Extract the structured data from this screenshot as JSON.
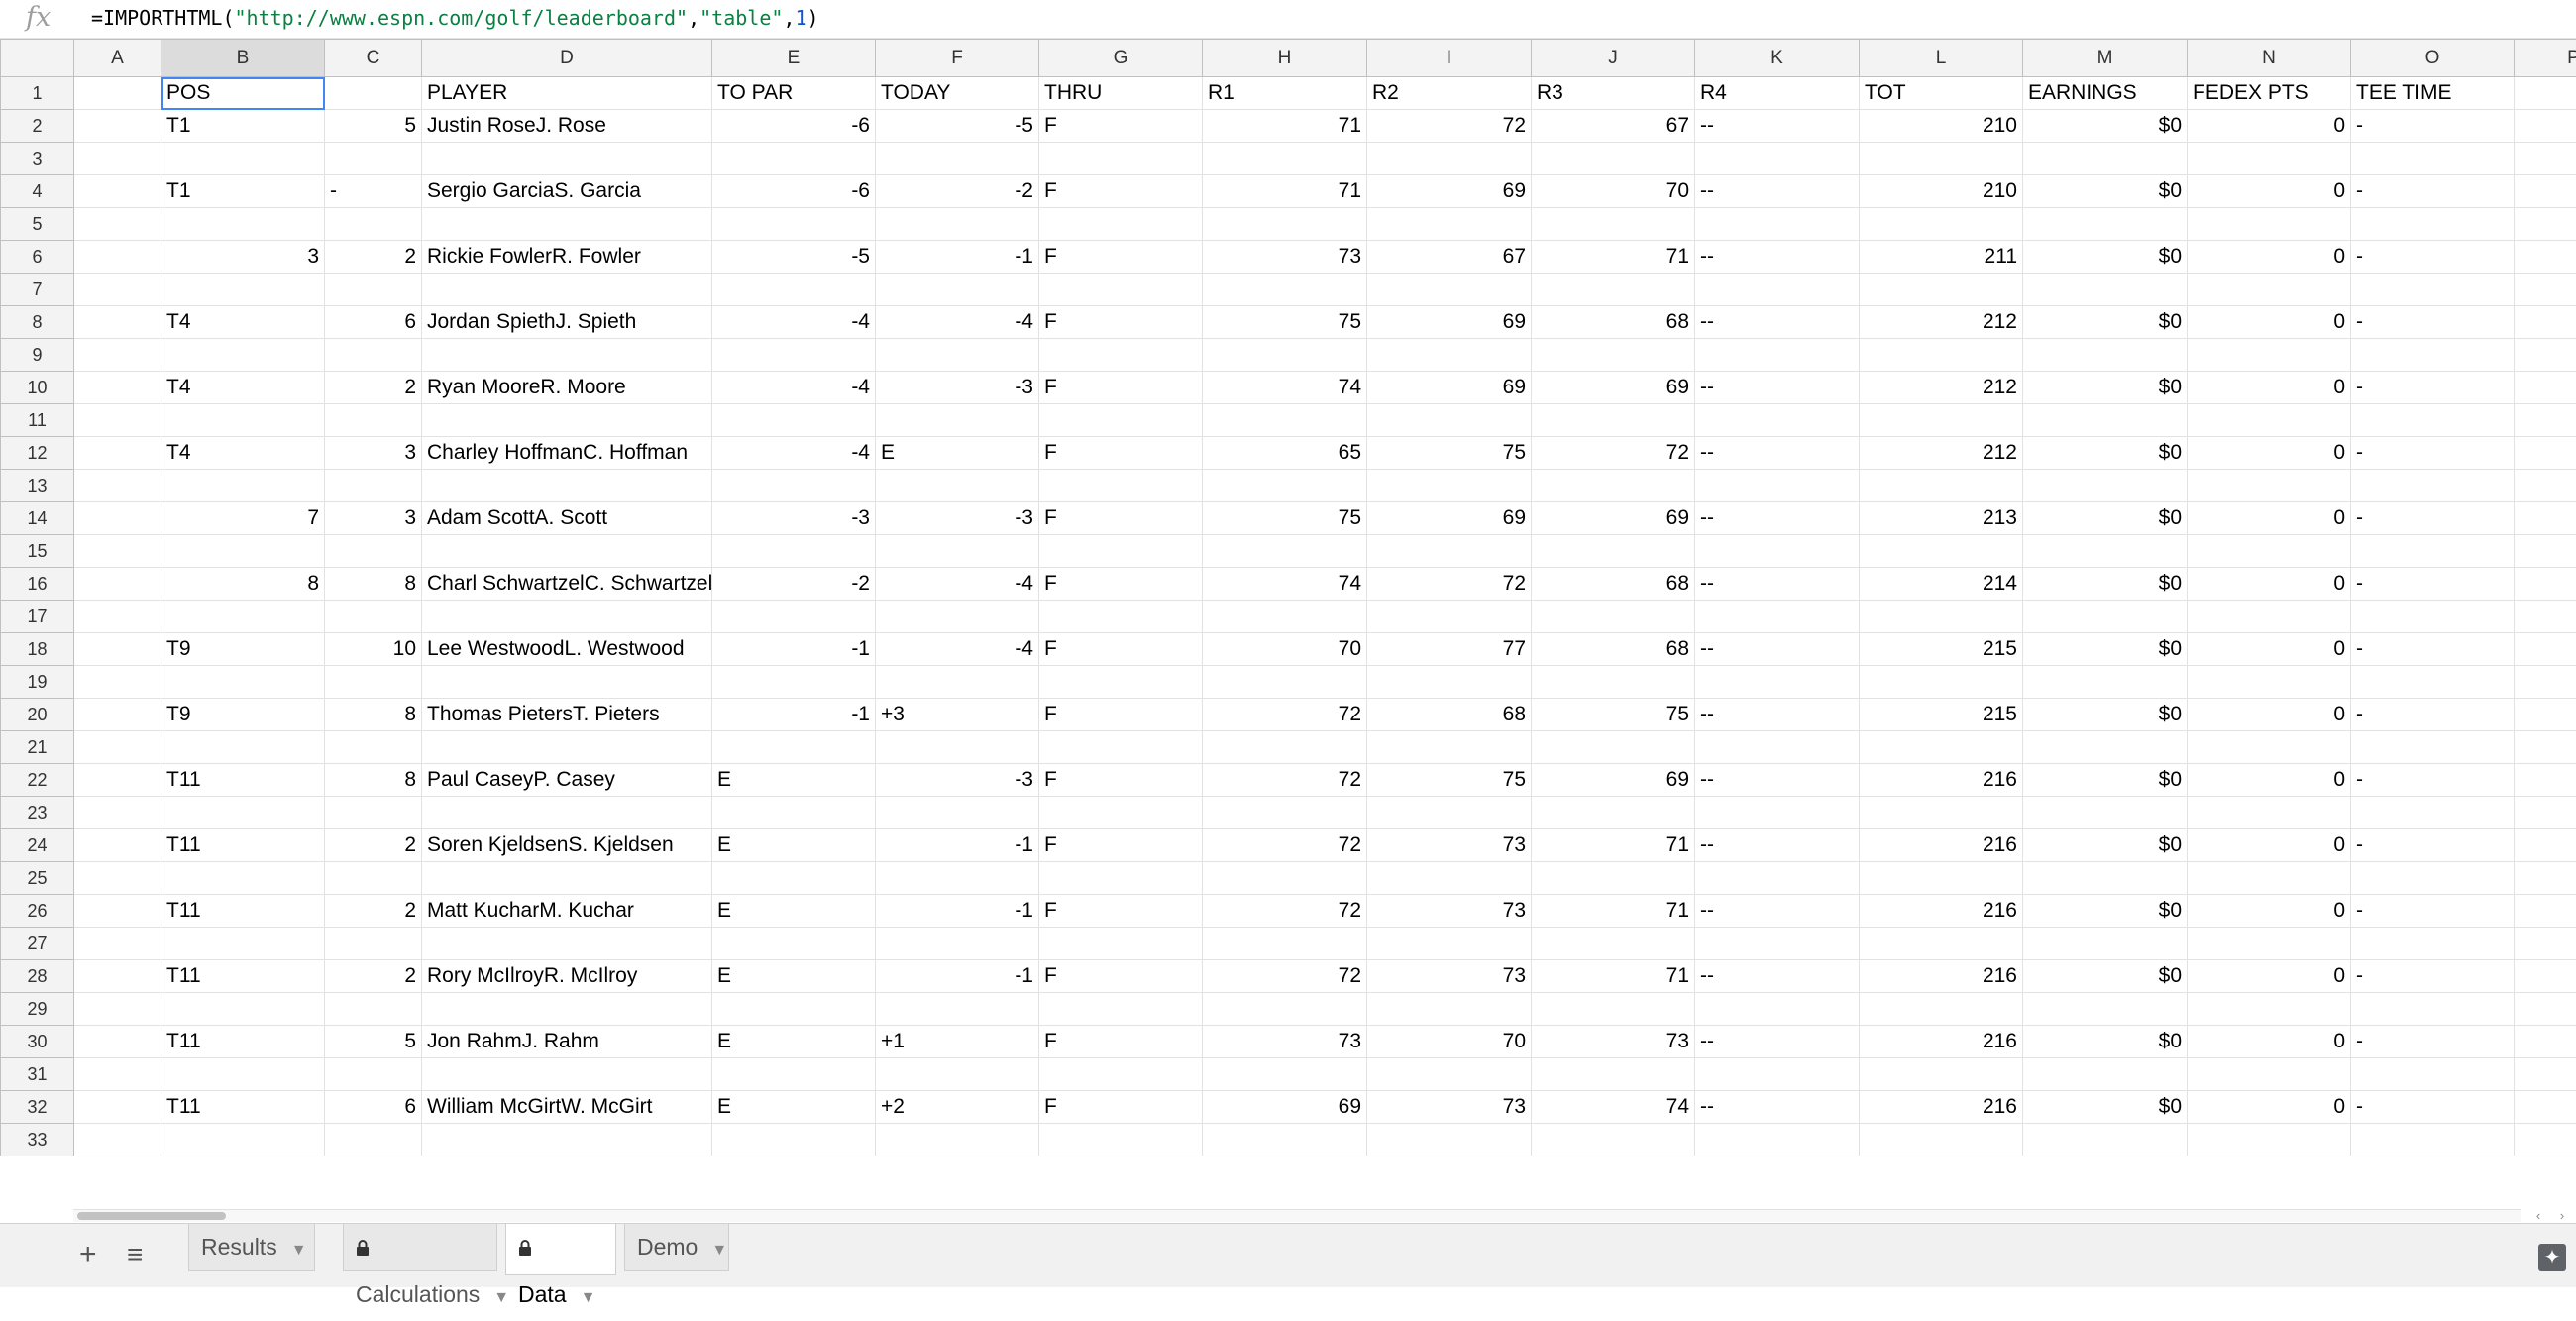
{
  "formula": {
    "prefix": "=IMPORTHTML(",
    "url": "\"http://www.espn.com/golf/leaderboard\"",
    "comma1": ",",
    "kind": "\"table\"",
    "comma2": ",",
    "index": "1",
    "suffix": ")"
  },
  "columns": [
    "A",
    "B",
    "C",
    "D",
    "E",
    "F",
    "G",
    "H",
    "I",
    "J",
    "K",
    "L",
    "M",
    "N",
    "O",
    "P"
  ],
  "header_row": [
    "",
    "POS",
    "",
    "PLAYER",
    "TO PAR",
    "TODAY",
    "THRU",
    "R1",
    "R2",
    "R3",
    "R4",
    "TOT",
    "EARNINGS",
    "FEDEX PTS",
    "TEE TIME"
  ],
  "players": [
    {
      "pos": "T1",
      "mv": "5",
      "name": "Justin RoseJ. Rose",
      "topar": "-6",
      "today": "-5",
      "thru": "F",
      "r1": "71",
      "r2": "72",
      "r3": "67",
      "r4": "--",
      "tot": "210",
      "earn": "$0",
      "fedex": "0",
      "tee": "-"
    },
    {
      "pos": "T1",
      "mv": "-",
      "name": "Sergio GarciaS. Garcia",
      "topar": "-6",
      "today": "-2",
      "thru": "F",
      "r1": "71",
      "r2": "69",
      "r3": "70",
      "r4": "--",
      "tot": "210",
      "earn": "$0",
      "fedex": "0",
      "tee": "-"
    },
    {
      "pos": "3",
      "mv": "2",
      "name": "Rickie FowlerR. Fowler",
      "topar": "-5",
      "today": "-1",
      "thru": "F",
      "r1": "73",
      "r2": "67",
      "r3": "71",
      "r4": "--",
      "tot": "211",
      "earn": "$0",
      "fedex": "0",
      "tee": "-"
    },
    {
      "pos": "T4",
      "mv": "6",
      "name": "Jordan SpiethJ. Spieth",
      "topar": "-4",
      "today": "-4",
      "thru": "F",
      "r1": "75",
      "r2": "69",
      "r3": "68",
      "r4": "--",
      "tot": "212",
      "earn": "$0",
      "fedex": "0",
      "tee": "-"
    },
    {
      "pos": "T4",
      "mv": "2",
      "name": "Ryan MooreR. Moore",
      "topar": "-4",
      "today": "-3",
      "thru": "F",
      "r1": "74",
      "r2": "69",
      "r3": "69",
      "r4": "--",
      "tot": "212",
      "earn": "$0",
      "fedex": "0",
      "tee": "-"
    },
    {
      "pos": "T4",
      "mv": "3",
      "name": "Charley HoffmanC. Hoffman",
      "topar": "-4",
      "today": "E",
      "thru": "F",
      "r1": "65",
      "r2": "75",
      "r3": "72",
      "r4": "--",
      "tot": "212",
      "earn": "$0",
      "fedex": "0",
      "tee": "-"
    },
    {
      "pos": "7",
      "mv": "3",
      "name": "Adam ScottA. Scott",
      "topar": "-3",
      "today": "-3",
      "thru": "F",
      "r1": "75",
      "r2": "69",
      "r3": "69",
      "r4": "--",
      "tot": "213",
      "earn": "$0",
      "fedex": "0",
      "tee": "-"
    },
    {
      "pos": "8",
      "mv": "8",
      "name": "Charl SchwartzelC. Schwartzel",
      "topar": "-2",
      "today": "-4",
      "thru": "F",
      "r1": "74",
      "r2": "72",
      "r3": "68",
      "r4": "--",
      "tot": "214",
      "earn": "$0",
      "fedex": "0",
      "tee": "-"
    },
    {
      "pos": "T9",
      "mv": "10",
      "name": "Lee WestwoodL. Westwood",
      "topar": "-1",
      "today": "-4",
      "thru": "F",
      "r1": "70",
      "r2": "77",
      "r3": "68",
      "r4": "--",
      "tot": "215",
      "earn": "$0",
      "fedex": "0",
      "tee": "-"
    },
    {
      "pos": "T9",
      "mv": "8",
      "name": "Thomas PietersT. Pieters",
      "topar": "-1",
      "today": "+3",
      "thru": "F",
      "r1": "72",
      "r2": "68",
      "r3": "75",
      "r4": "--",
      "tot": "215",
      "earn": "$0",
      "fedex": "0",
      "tee": "-"
    },
    {
      "pos": "T11",
      "mv": "8",
      "name": "Paul CaseyP. Casey",
      "topar": "E",
      "today": "-3",
      "thru": "F",
      "r1": "72",
      "r2": "75",
      "r3": "69",
      "r4": "--",
      "tot": "216",
      "earn": "$0",
      "fedex": "0",
      "tee": "-"
    },
    {
      "pos": "T11",
      "mv": "2",
      "name": "Soren KjeldsenS. Kjeldsen",
      "topar": "E",
      "today": "-1",
      "thru": "F",
      "r1": "72",
      "r2": "73",
      "r3": "71",
      "r4": "--",
      "tot": "216",
      "earn": "$0",
      "fedex": "0",
      "tee": "-"
    },
    {
      "pos": "T11",
      "mv": "2",
      "name": "Matt KucharM. Kuchar",
      "topar": "E",
      "today": "-1",
      "thru": "F",
      "r1": "72",
      "r2": "73",
      "r3": "71",
      "r4": "--",
      "tot": "216",
      "earn": "$0",
      "fedex": "0",
      "tee": "-"
    },
    {
      "pos": "T11",
      "mv": "2",
      "name": "Rory McIlroyR. McIlroy",
      "topar": "E",
      "today": "-1",
      "thru": "F",
      "r1": "72",
      "r2": "73",
      "r3": "71",
      "r4": "--",
      "tot": "216",
      "earn": "$0",
      "fedex": "0",
      "tee": "-"
    },
    {
      "pos": "T11",
      "mv": "5",
      "name": "Jon RahmJ. Rahm",
      "topar": "E",
      "today": "+1",
      "thru": "F",
      "r1": "73",
      "r2": "70",
      "r3": "73",
      "r4": "--",
      "tot": "216",
      "earn": "$0",
      "fedex": "0",
      "tee": "-"
    },
    {
      "pos": "T11",
      "mv": "6",
      "name": "William McGirtW. McGirt",
      "topar": "E",
      "today": "+2",
      "thru": "F",
      "r1": "69",
      "r2": "73",
      "r3": "74",
      "r4": "--",
      "tot": "216",
      "earn": "$0",
      "fedex": "0",
      "tee": "-"
    }
  ],
  "total_rows": 33,
  "sheet_tabs": [
    {
      "label": "Results",
      "locked": false,
      "active": false
    },
    {
      "label": "Calculations",
      "locked": true,
      "active": false
    },
    {
      "label": "Data",
      "locked": true,
      "active": true
    },
    {
      "label": "Demo",
      "locked": false,
      "active": false
    }
  ],
  "icons": {
    "add_sheet": "plus-icon",
    "all_sheets": "list-icon",
    "explore": "explore-icon",
    "lock": "lock-icon",
    "caret": "caret-down-icon"
  }
}
